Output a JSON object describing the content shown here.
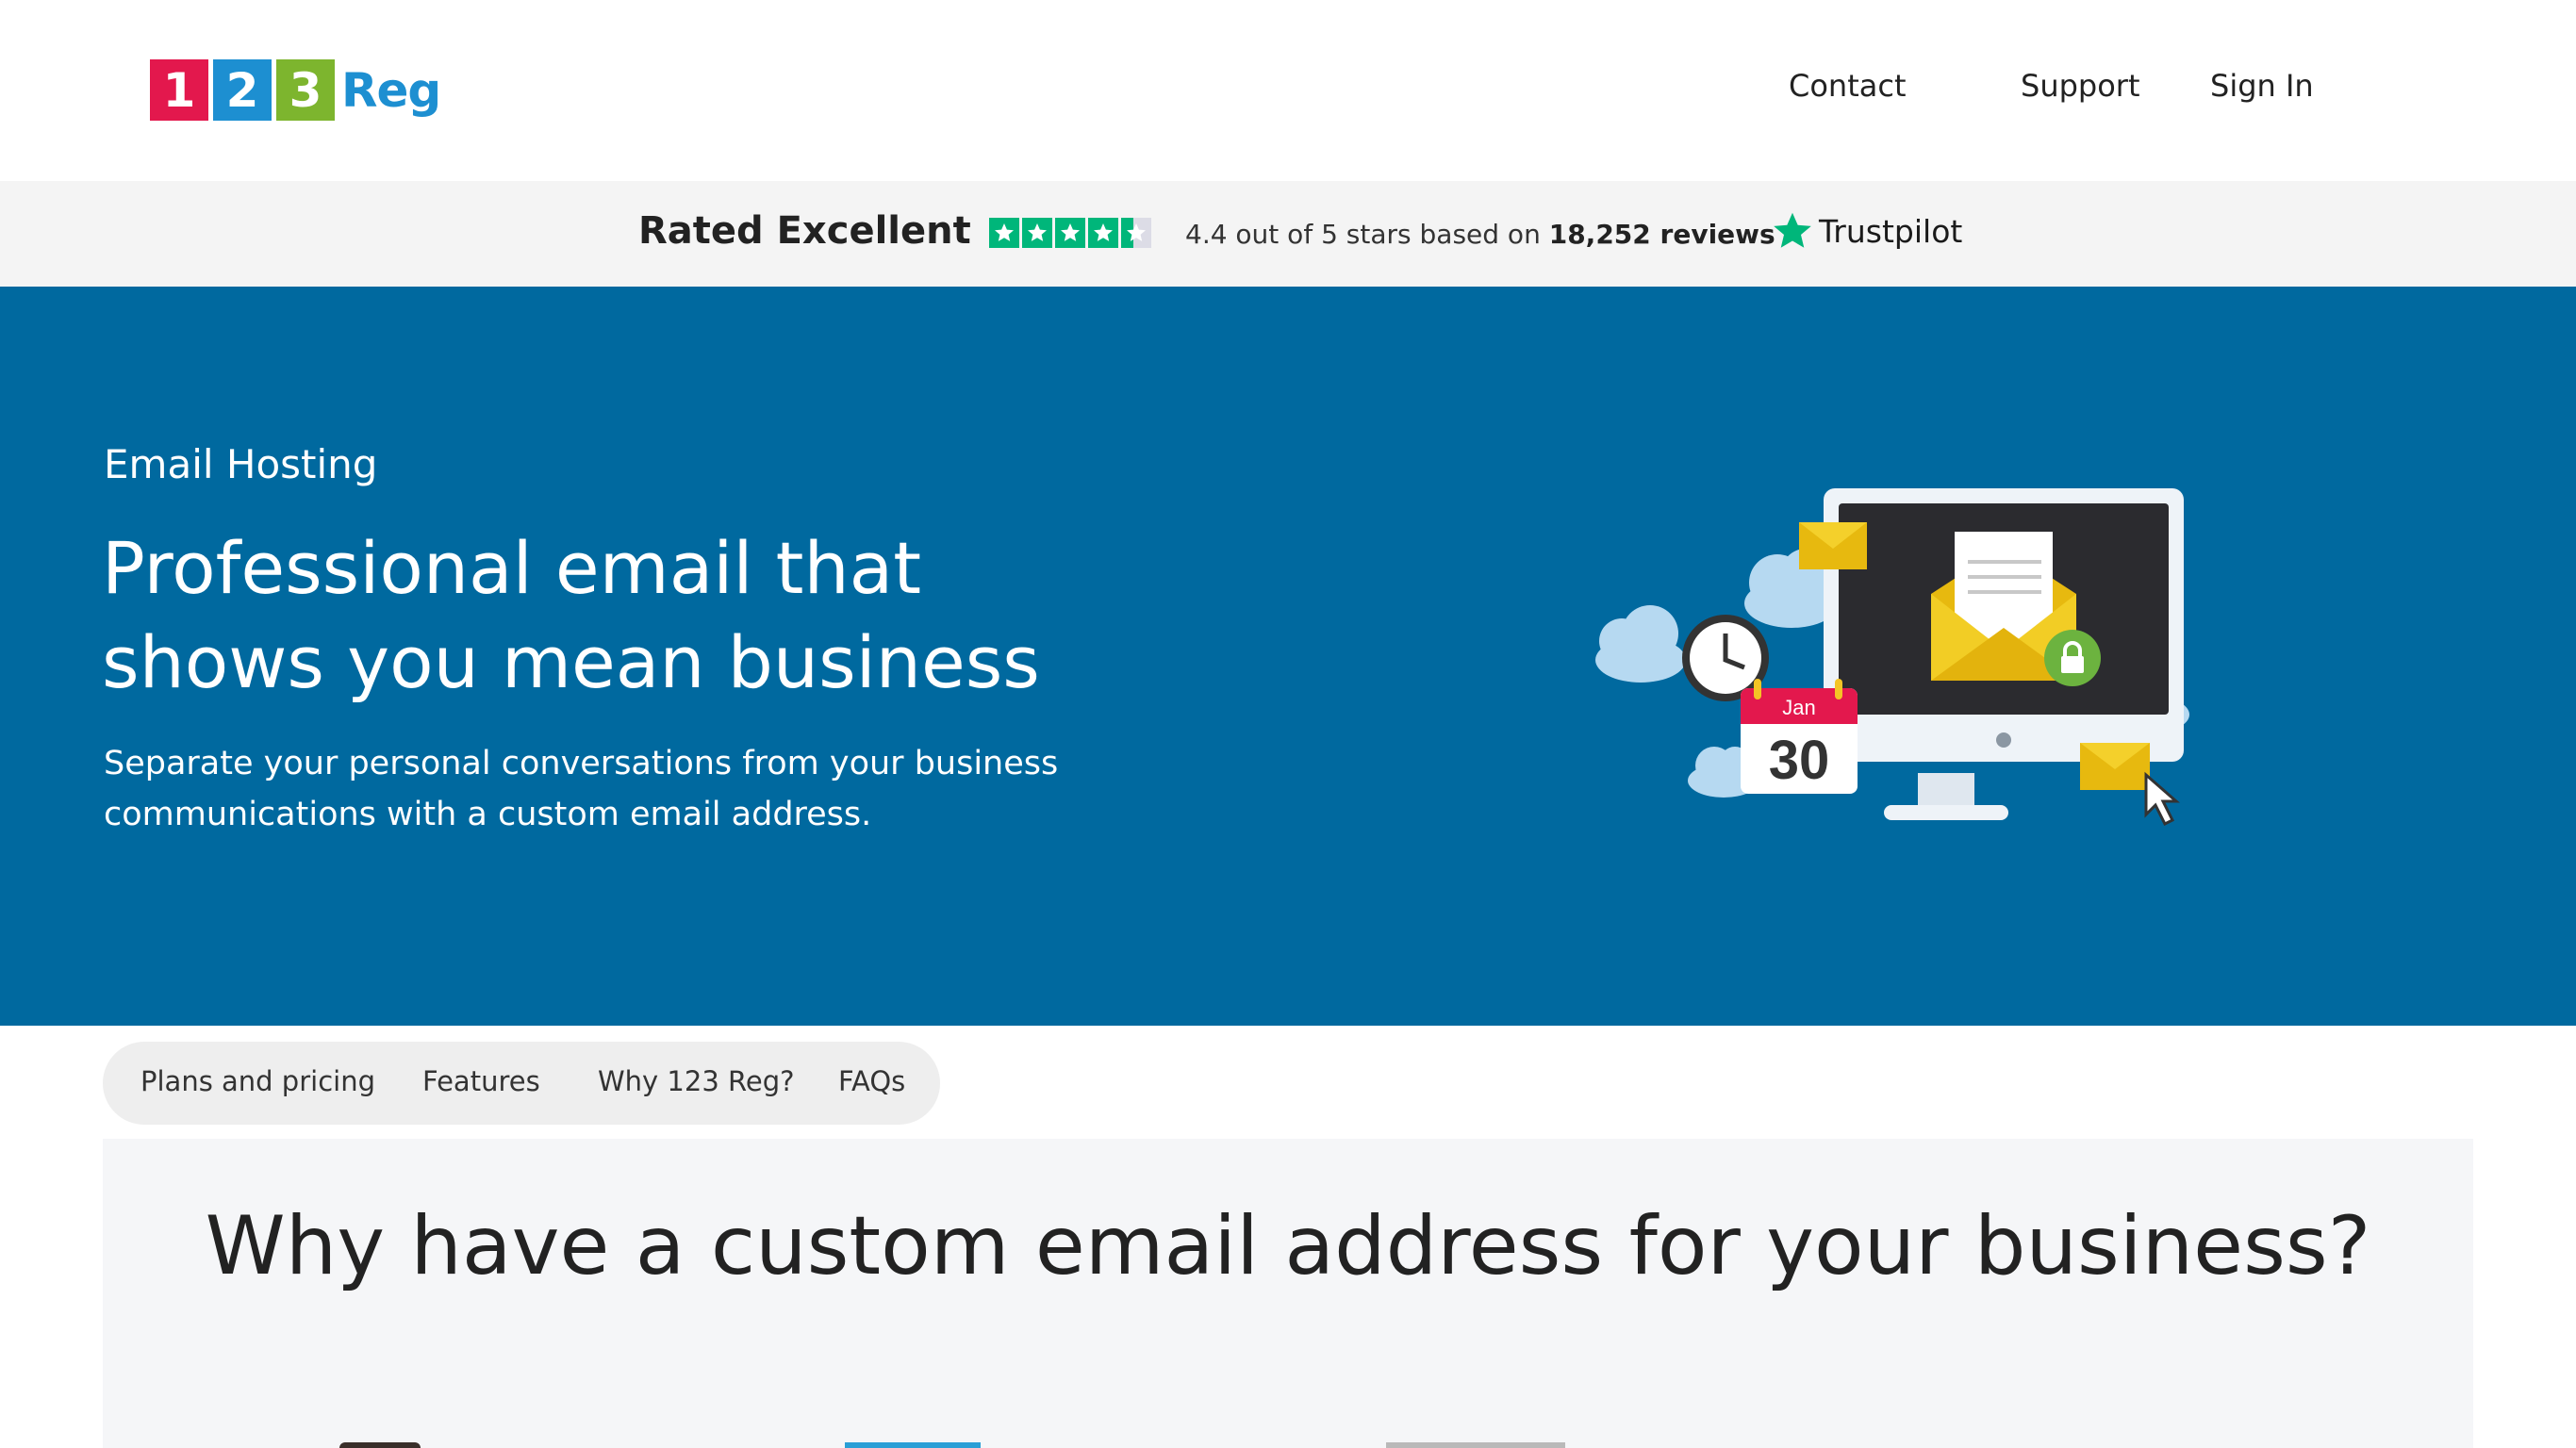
{
  "header": {
    "logo": {
      "digits": [
        "1",
        "2",
        "3"
      ],
      "word": "Reg",
      "colors": [
        "#e3184d",
        "#1d8fd1",
        "#7db52e"
      ]
    },
    "nav": {
      "contact": "Contact",
      "support": "Support",
      "sign_in": "Sign In"
    }
  },
  "trustpilot": {
    "rated": "Rated Excellent",
    "rating_text": "4.4 out of 5 stars based on",
    "reviews": "18,252 reviews",
    "brand": "Trustpilot",
    "stars": 4.4,
    "color": "#00b67a"
  },
  "hero": {
    "eyebrow": "Email Hosting",
    "title": "Professional email that shows you mean business",
    "subtitle": "Separate your personal conversations from your business communications with a custom email address.",
    "calendar": {
      "month": "Jan",
      "day": "30"
    },
    "background": "#00699f"
  },
  "subnav": {
    "plans": "Plans and pricing",
    "features": "Features",
    "why": "Why 123 Reg?",
    "faqs": "FAQs"
  },
  "section": {
    "title": "Why have a custom email address for your business?"
  }
}
